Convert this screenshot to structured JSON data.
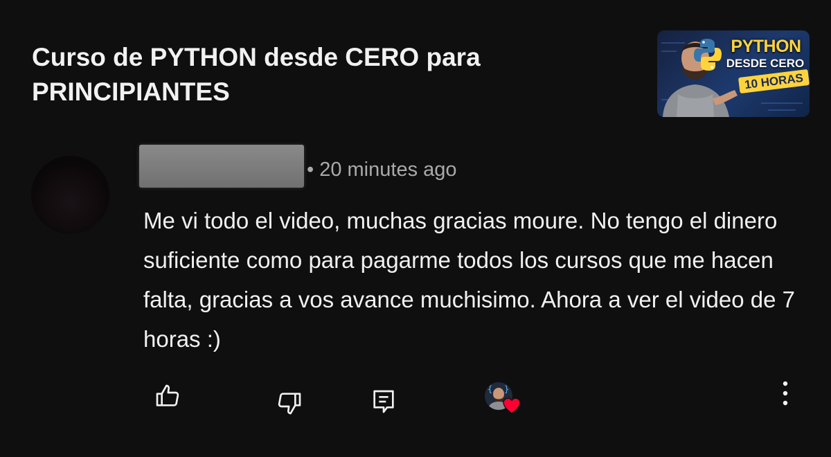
{
  "video": {
    "title": "Curso de PYTHON desde CERO para PRINCIPIANTES",
    "thumbnail": {
      "title": "PYTHON",
      "subtitle": "DESDE CERO",
      "badge": "10 HORAS",
      "logo_icon": "python-logo-icon"
    }
  },
  "comment": {
    "time": "• 20 minutes ago",
    "text": "Me vi todo el video, muchas gracias moure. No tengo el dinero suficiente como para pagarme todos los cursos que me hacen falta, gracias a vos avance muchisimo. Ahora a ver el video de 7 horas :)"
  },
  "actions": {
    "like_icon": "thumbs-up-icon",
    "dislike_icon": "thumbs-down-icon",
    "reply_icon": "reply-comment-icon",
    "creator_heart_icon": "heart-icon",
    "more_icon": "more-vertical-icon"
  },
  "colors": {
    "background": "#0f0f0f",
    "text_primary": "#f1f1f1",
    "text_secondary": "#aaaaaa",
    "heart": "#ff0033",
    "python_yellow": "#ffd43b",
    "python_blue": "#3776ab"
  }
}
